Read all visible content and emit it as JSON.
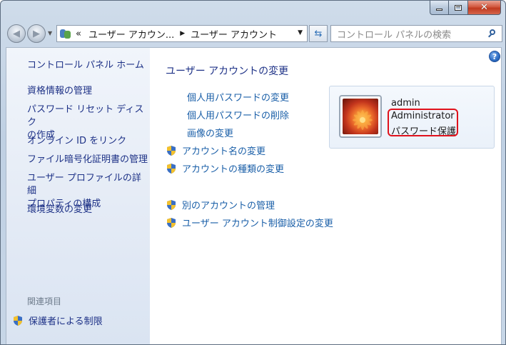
{
  "window": {
    "minimize_glyph": "minimize-icon",
    "maximize_glyph": "maximize-icon",
    "close_glyph": "✕"
  },
  "navbar": {
    "back_icon": "back-arrow-icon",
    "forward_icon": "forward-arrow-icon",
    "address": {
      "prefix": "«",
      "crumb1": "ユーザー アカウン...",
      "separator": "▶",
      "crumb2": "ユーザー アカウント"
    },
    "refresh_icon": "refresh-icon",
    "search_placeholder": "コントロール パネルの検索"
  },
  "sidebar": {
    "home": "コントロール パネル ホーム",
    "links": [
      "資格情報の管理",
      "パスワード リセット ディスク\nの作成",
      "オンライン ID をリンク",
      "ファイル暗号化証明書の管理",
      "ユーザー プロファイルの詳細\nプロパティの構成",
      "環境変数の変更"
    ],
    "related_heading": "関連項目",
    "parental_controls": "保護者による制限"
  },
  "main": {
    "title": "ユーザー アカウントの変更",
    "tasks": [
      "個人用パスワードの変更",
      "個人用パスワードの削除",
      "画像の変更",
      "アカウント名の変更",
      "アカウントの種類の変更",
      "別のアカウントの管理",
      "ユーザー アカウント制御設定の変更"
    ],
    "help": "?"
  },
  "user": {
    "name": "admin",
    "role": "Administrator",
    "password_status": "パスワード保護"
  },
  "colors": {
    "link": "#1a5fa8",
    "sidebar_link": "#1e3287",
    "highlight": "#e0121c"
  }
}
